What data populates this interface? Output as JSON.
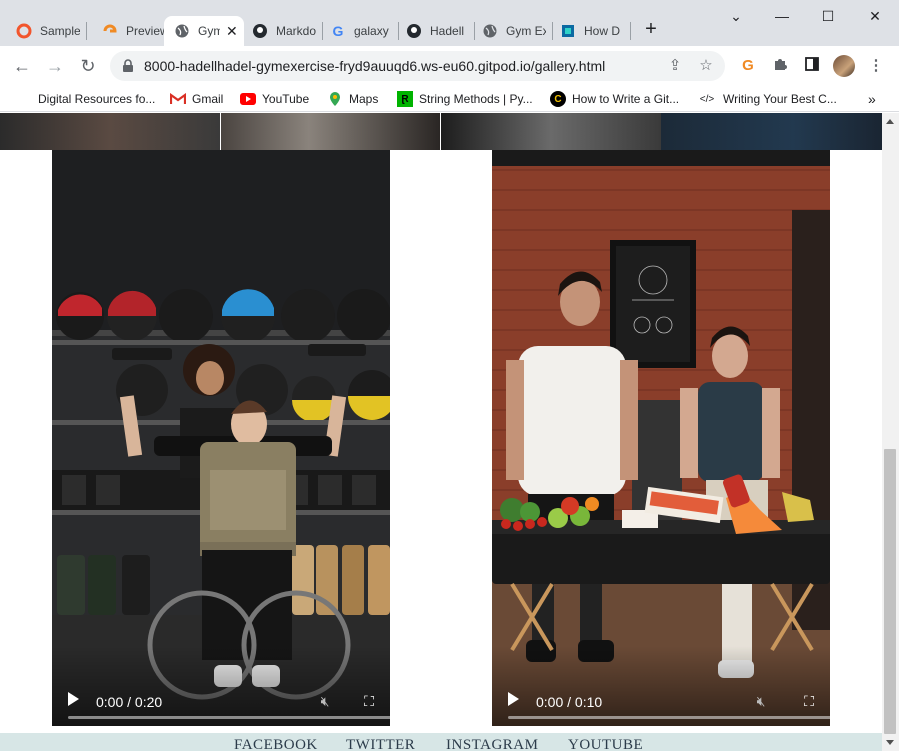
{
  "browser": {
    "tabs": [
      {
        "title": "Sample",
        "icon": "opera-icon"
      },
      {
        "title": "Preview",
        "icon": "preview-icon"
      },
      {
        "title": "Gym",
        "icon": "globe-icon",
        "active": true
      },
      {
        "title": "Markdo",
        "icon": "github-icon"
      },
      {
        "title": "galaxy",
        "icon": "google-icon"
      },
      {
        "title": "Hadell",
        "icon": "github-icon"
      },
      {
        "title": "Gym Ex",
        "icon": "globe-icon"
      },
      {
        "title": "How D",
        "icon": "howd-icon"
      }
    ],
    "new_tab": "+",
    "url": "8000-hadellhadel-gymexercise-fryd9auuqd6.ws-eu60.gitpod.io/gallery.html",
    "bookmarks": [
      {
        "label": "Digital Resources fo...",
        "icon": "none"
      },
      {
        "label": "Gmail",
        "icon": "gmail-icon"
      },
      {
        "label": "YouTube",
        "icon": "youtube-icon"
      },
      {
        "label": "Maps",
        "icon": "maps-icon"
      },
      {
        "label": "String Methods | Py...",
        "icon": "string-methods-icon"
      },
      {
        "label": "How to Write a Git...",
        "icon": "c-icon"
      },
      {
        "label": "Writing Your Best C...",
        "icon": "code-icon"
      }
    ],
    "more_bookmarks": "»"
  },
  "page": {
    "videos": [
      {
        "time": "0:00 / 0:20",
        "progress": 0,
        "name": "wheelchair-lifter-video"
      },
      {
        "time": "0:00 / 0:10",
        "progress": 0,
        "name": "nutrition-table-video"
      }
    ],
    "footer_links": [
      "FACEBOOK",
      "TWITTER",
      "INSTAGRAM",
      "YOUTUBE"
    ]
  },
  "colors": {
    "tabstrip": "#dee1e6",
    "footer_band": "#d7e6e6"
  }
}
